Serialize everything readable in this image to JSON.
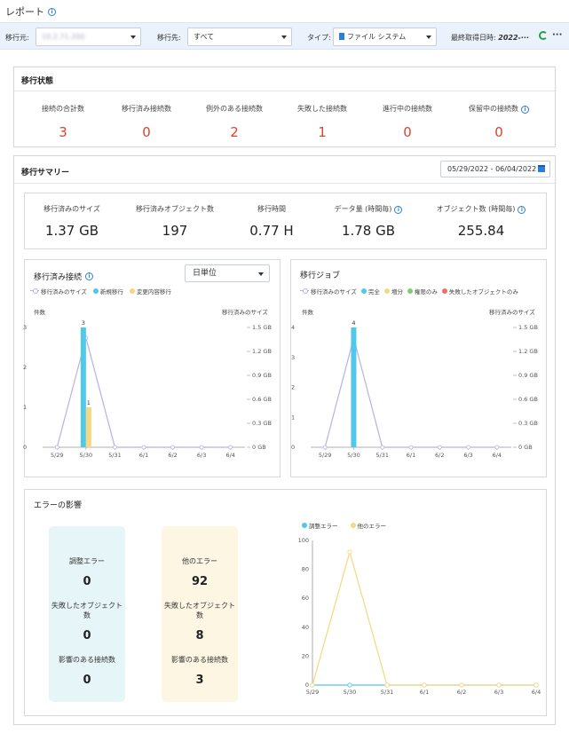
{
  "header": {
    "title": "レポート"
  },
  "filters": {
    "source_label": "移行元:",
    "source_value": "10.2.71.200",
    "destination_label": "移行先:",
    "destination_value": "すべて",
    "type_label": "タイプ:",
    "type_value": "ファイル システム",
    "last_fetch_label": "最終取得日時:",
    "last_fetch_value": "2022-···"
  },
  "migration_status": {
    "title": "移行状態",
    "stats": [
      {
        "label": "接続の合計数",
        "value": "3"
      },
      {
        "label": "移行済み接続数",
        "value": "0"
      },
      {
        "label": "例外のある接続数",
        "value": "2"
      },
      {
        "label": "失敗した接続数",
        "value": "1"
      },
      {
        "label": "進行中の接続数",
        "value": "0"
      },
      {
        "label": "保留中の接続数",
        "value": "0"
      }
    ]
  },
  "migration_summary": {
    "title": "移行サマリー",
    "date_range": "05/29/2022 - 06/04/2022",
    "stats": [
      {
        "label": "移行済みのサイズ",
        "value": "1.37 GB"
      },
      {
        "label": "移行済みオブジェクト数",
        "value": "197"
      },
      {
        "label": "移行時間",
        "value": "0.77 H"
      },
      {
        "label": "データ量 (時間毎)",
        "value": "1.78 GB"
      },
      {
        "label": "オブジェクト数 (時間毎)",
        "value": "255.84"
      }
    ]
  },
  "migrated_connections": {
    "title": "移行済み接続",
    "granularity": "日単位",
    "left_unit": "件数",
    "right_unit": "移行済みのサイズ",
    "legend": [
      {
        "name": "移行済みのサイズ",
        "color": "#b7b0e6",
        "kind": "line"
      },
      {
        "name": "新規移行",
        "color": "#4fc8ec",
        "kind": "bar"
      },
      {
        "name": "変更内容移行",
        "color": "#f7d77f",
        "kind": "bar"
      }
    ]
  },
  "migration_jobs": {
    "title": "移行ジョブ",
    "left_unit": "件数",
    "right_unit": "移行済みのサイズ",
    "legend": [
      {
        "name": "移行済みのサイズ",
        "color": "#b7b0e6",
        "kind": "line"
      },
      {
        "name": "完全",
        "color": "#4fc8ec",
        "kind": "bar"
      },
      {
        "name": "増分",
        "color": "#f7d77f",
        "kind": "bar"
      },
      {
        "name": "権限のみ",
        "color": "#7dcf6f",
        "kind": "bar"
      },
      {
        "name": "失敗したオブジェクトのみ",
        "color": "#f06d6d",
        "kind": "bar"
      }
    ]
  },
  "error_impact": {
    "title": "エラーの影響",
    "sync_box": {
      "title": "調整エラー",
      "count": "0",
      "failed_label": "失敗したオブジェクト数",
      "failed": "0",
      "affected_label": "影響のある接続数",
      "affected": "0",
      "bg": "#e6f6f8"
    },
    "other_box": {
      "title": "他のエラー",
      "count": "92",
      "failed_label": "失敗したオブジェクト数",
      "failed": "8",
      "affected_label": "影響のある接続数",
      "affected": "3",
      "bg": "#fdf6e3"
    },
    "legend": [
      {
        "name": "調整エラー",
        "color": "#4fc8ec"
      },
      {
        "name": "他のエラー",
        "color": "#f7d77f"
      }
    ]
  },
  "chart_data": [
    {
      "type": "bar",
      "categories": [
        "5/29",
        "5/30",
        "5/31",
        "6/1",
        "6/2",
        "6/3",
        "6/4"
      ],
      "left_axis": {
        "label": "件数",
        "ticks": [
          0,
          1,
          2,
          3
        ],
        "max": 3
      },
      "right_axis": {
        "label": "移行済みのサイズ",
        "ticks": [
          "0 GB",
          "0.3 GB",
          "0.6 GB",
          "0.9 GB",
          "1.2 GB",
          "1.5 GB"
        ],
        "max": 1.5
      },
      "series": [
        {
          "name": "新規移行",
          "kind": "bar",
          "color": "#4fc8ec",
          "values": [
            0,
            3,
            0,
            0,
            0,
            0,
            0
          ]
        },
        {
          "name": "変更内容移行",
          "kind": "bar",
          "color": "#f7d77f",
          "values": [
            0,
            1,
            0,
            0,
            0,
            0,
            0
          ]
        },
        {
          "name": "移行済みのサイズ",
          "kind": "line",
          "axis": "right",
          "color": "#b7b0e6",
          "values": [
            0,
            1.37,
            0,
            0,
            0,
            0,
            0
          ]
        }
      ],
      "data_labels": [
        {
          "x": "5/30",
          "series": "新規移行",
          "text": "3"
        },
        {
          "x": "5/30",
          "series": "変更内容移行",
          "text": "1"
        }
      ]
    },
    {
      "type": "bar",
      "categories": [
        "5/29",
        "5/30",
        "5/31",
        "6/1",
        "6/2",
        "6/3",
        "6/4"
      ],
      "left_axis": {
        "label": "件数",
        "ticks": [
          0,
          1,
          2,
          3,
          4
        ],
        "max": 4
      },
      "right_axis": {
        "label": "移行済みのサイズ",
        "ticks": [
          "0 GB",
          "0.3 GB",
          "0.6 GB",
          "0.9 GB",
          "1.2 GB",
          "1.5 GB"
        ],
        "max": 1.5
      },
      "series": [
        {
          "name": "完全",
          "kind": "bar",
          "color": "#4fc8ec",
          "values": [
            0,
            4,
            0,
            0,
            0,
            0,
            0
          ]
        },
        {
          "name": "増分",
          "kind": "bar",
          "color": "#f7d77f",
          "values": [
            0,
            0,
            0,
            0,
            0,
            0,
            0
          ]
        },
        {
          "name": "権限のみ",
          "kind": "bar",
          "color": "#7dcf6f",
          "values": [
            0,
            0,
            0,
            0,
            0,
            0,
            0
          ]
        },
        {
          "name": "失敗したオブジェクトのみ",
          "kind": "bar",
          "color": "#f06d6d",
          "values": [
            0,
            0,
            0,
            0,
            0,
            0,
            0
          ]
        },
        {
          "name": "移行済みのサイズ",
          "kind": "line",
          "axis": "right",
          "color": "#b7b0e6",
          "values": [
            0,
            1.37,
            0,
            0,
            0,
            0,
            0
          ]
        }
      ],
      "data_labels": [
        {
          "x": "5/30",
          "series": "完全",
          "text": "4"
        }
      ]
    },
    {
      "type": "line",
      "categories": [
        "5/29",
        "5/30",
        "5/31",
        "6/1",
        "6/2",
        "6/3",
        "6/4"
      ],
      "y_axis": {
        "ticks": [
          0,
          20,
          40,
          60,
          80,
          100
        ],
        "max": 100
      },
      "series": [
        {
          "name": "調整エラー",
          "color": "#4fc8ec",
          "values": [
            0,
            0,
            0,
            0,
            0,
            0,
            0
          ]
        },
        {
          "name": "他のエラー",
          "color": "#f7d77f",
          "values": [
            0,
            92,
            0,
            0,
            0,
            0,
            0
          ]
        }
      ]
    }
  ]
}
